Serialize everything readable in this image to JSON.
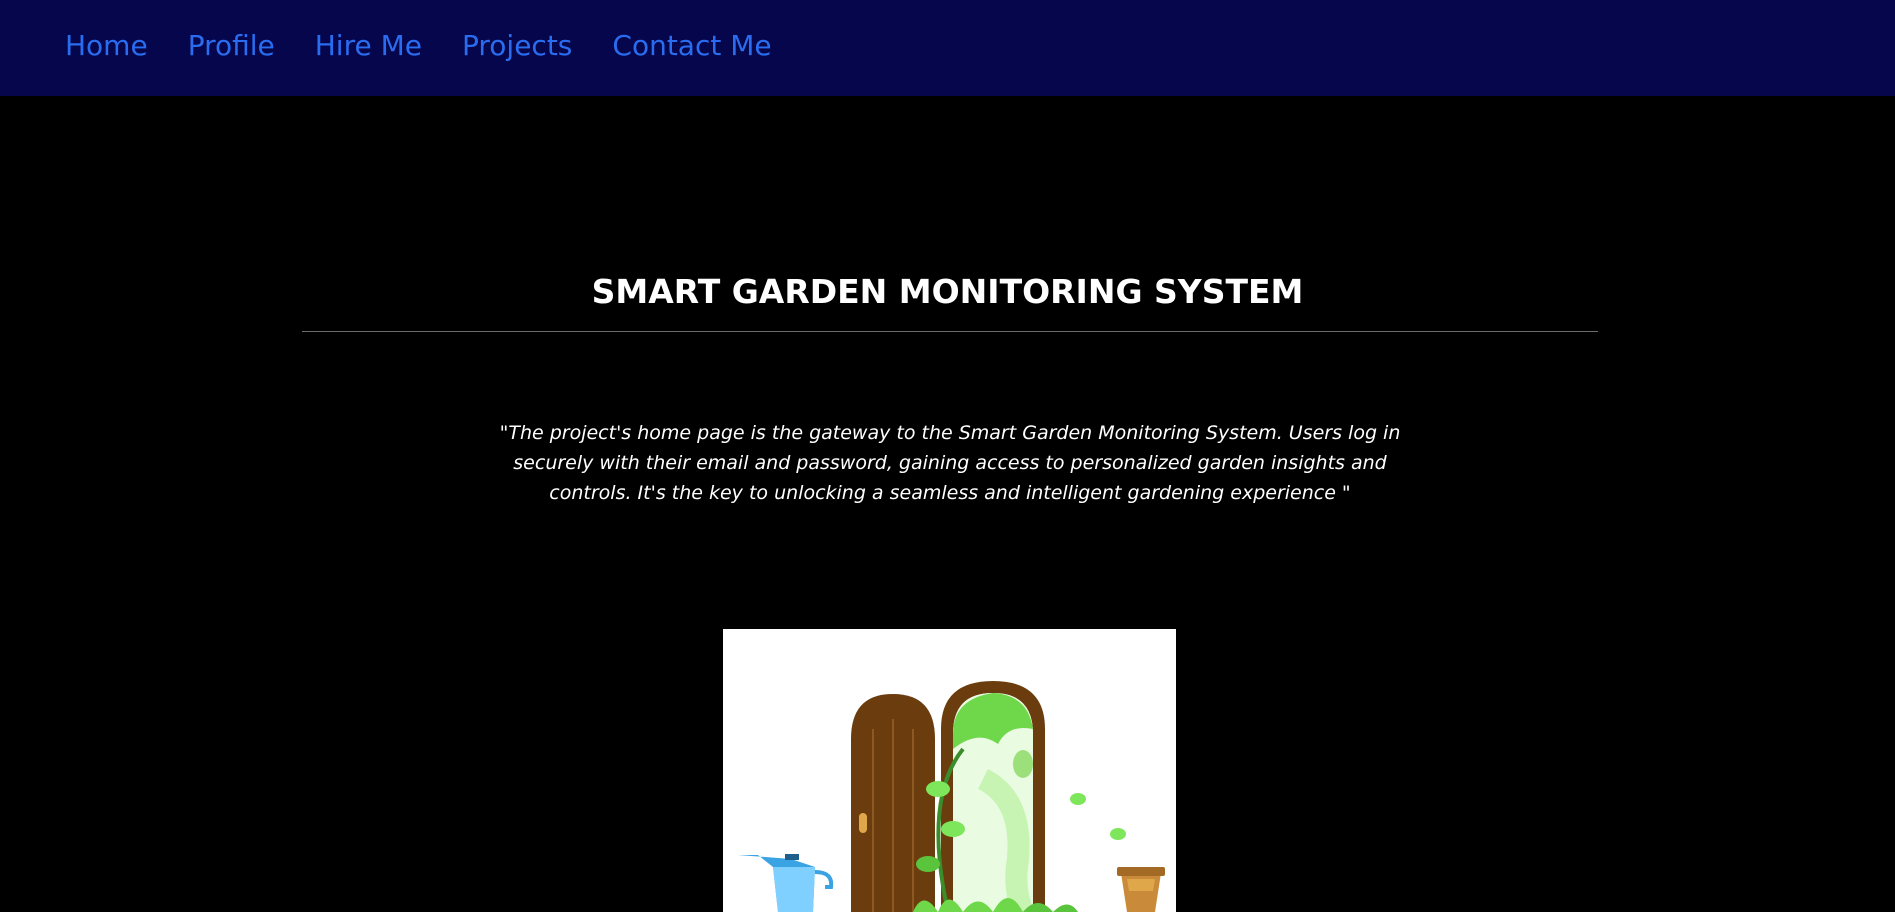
{
  "nav": {
    "items": [
      {
        "label": "Home"
      },
      {
        "label": "Profile"
      },
      {
        "label": "Hire Me"
      },
      {
        "label": "Projects"
      },
      {
        "label": "Contact Me"
      }
    ]
  },
  "project": {
    "title": "SMART GARDEN MONITORING SYSTEM",
    "description": "\"The project's home page is the gateway to the Smart Garden Monitoring System. Users log in securely with their email and password, gaining access to personalized garden insights and controls. It's the key to unlocking a seamless and intelligent gardening experience \"",
    "image": {
      "icons": [
        "watering-can-icon",
        "garden-door-icon",
        "vine-icon",
        "flower-pot-icon"
      ]
    }
  },
  "colors": {
    "navbar_bg": "#05064c",
    "nav_link": "#2a6cf0",
    "page_bg": "#000000",
    "text": "#ffffff"
  }
}
